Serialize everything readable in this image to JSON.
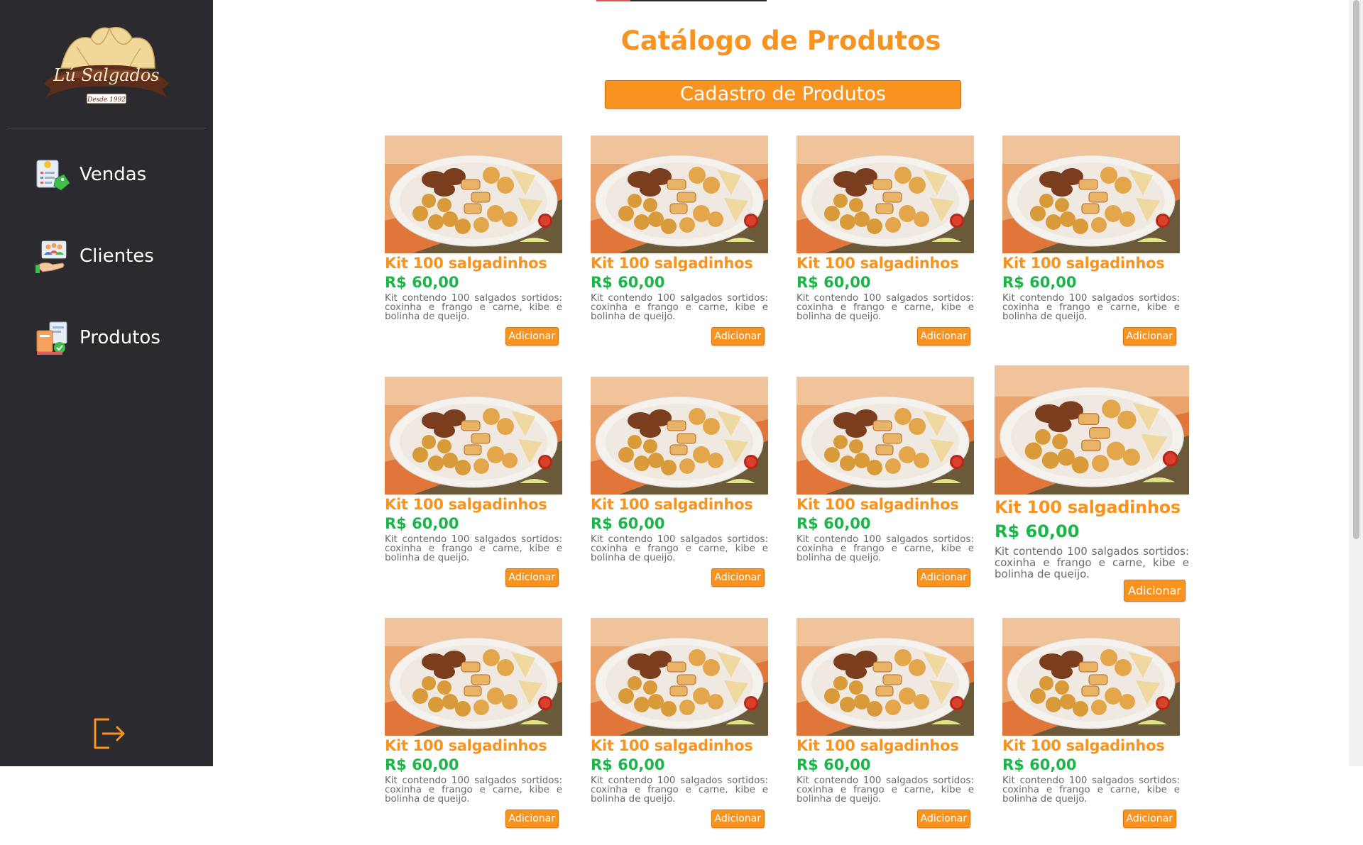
{
  "sidebar": {
    "logo": {
      "brand_text": "Lú Salgados",
      "since_text": "Desde 1992"
    },
    "items": [
      {
        "label": "Vendas",
        "icon": "sales-receipt-icon"
      },
      {
        "label": "Clientes",
        "icon": "clients-icon"
      },
      {
        "label": "Produtos",
        "icon": "products-icon"
      }
    ],
    "logout_icon": "logout-icon"
  },
  "main": {
    "title": "Catálogo de Produtos",
    "register_button": "Cadastro de Produtos",
    "products": [
      {
        "name": "Kit 100 salgadinhos",
        "price": "R$ 60,00",
        "description": "Kit contendo 100 salgados sortidos: coxinha e frango e carne, kibe e bolinha de queijo.",
        "add_label": "Adicionar"
      },
      {
        "name": "Kit 100 salgadinhos",
        "price": "R$ 60,00",
        "description": "Kit contendo 100 salgados sortidos: coxinha e frango e carne, kibe e bolinha de queijo.",
        "add_label": "Adicionar"
      },
      {
        "name": "Kit 100 salgadinhos",
        "price": "R$ 60,00",
        "description": "Kit contendo 100 salgados sortidos: coxinha e frango e carne, kibe e bolinha de queijo.",
        "add_label": "Adicionar"
      },
      {
        "name": "Kit 100 salgadinhos",
        "price": "R$ 60,00",
        "description": "Kit contendo 100 salgados sortidos: coxinha e frango e carne, kibe e bolinha de queijo.",
        "add_label": "Adicionar"
      },
      {
        "name": "Kit 100 salgadinhos",
        "price": "R$ 60,00",
        "description": "Kit contendo 100 salgados sortidos: coxinha e frango e carne, kibe e bolinha de queijo.",
        "add_label": "Adicionar"
      },
      {
        "name": "Kit 100 salgadinhos",
        "price": "R$ 60,00",
        "description": "Kit contendo 100 salgados sortidos: coxinha e frango e carne, kibe e bolinha de queijo.",
        "add_label": "Adicionar"
      },
      {
        "name": "Kit 100 salgadinhos",
        "price": "R$ 60,00",
        "description": "Kit contendo 100 salgados sortidos: coxinha e frango e carne, kibe e bolinha de queijo.",
        "add_label": "Adicionar"
      },
      {
        "name": "Kit 100 salgadinhos",
        "price": "R$ 60,00",
        "description": "Kit contendo 100 salgados sortidos: coxinha e frango e carne, kibe e bolinha de queijo.",
        "add_label": "Adicionar"
      },
      {
        "name": "Kit 100 salgadinhos",
        "price": "R$ 60,00",
        "description": "Kit contendo 100 salgados sortidos: coxinha e frango e carne, kibe e bolinha de queijo.",
        "add_label": "Adicionar"
      },
      {
        "name": "Kit 100 salgadinhos",
        "price": "R$ 60,00",
        "description": "Kit contendo 100 salgados sortidos: coxinha e frango e carne, kibe e bolinha de queijo.",
        "add_label": "Adicionar"
      },
      {
        "name": "Kit 100 salgadinhos",
        "price": "R$ 60,00",
        "description": "Kit contendo 100 salgados sortidos: coxinha e frango e carne, kibe e bolinha de queijo.",
        "add_label": "Adicionar"
      },
      {
        "name": "Kit 100 salgadinhos",
        "price": "R$ 60,00",
        "description": "Kit contendo 100 salgados sortidos: coxinha e frango e carne, kibe e bolinha de queijo.",
        "add_label": "Adicionar"
      }
    ]
  },
  "colors": {
    "sidebar_bg": "#2b2a2e",
    "accent_orange": "#f7931e",
    "price_green": "#1cb54a",
    "text_gray": "#6a6a6a"
  }
}
